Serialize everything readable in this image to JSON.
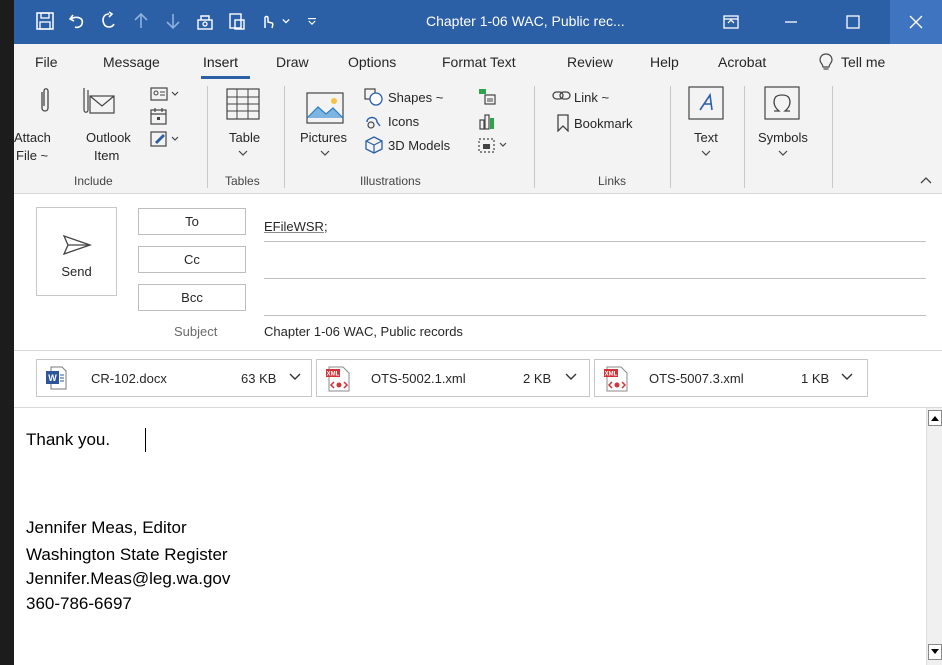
{
  "window": {
    "title": "Chapter 1-06 WAC, Public rec...",
    "accent": "#2b5fa6"
  },
  "quick_access": [
    "save-icon",
    "undo-icon",
    "redo-icon",
    "up-icon",
    "down-icon",
    "repeat-icon",
    "paste-icon",
    "touch-icon",
    "customize-icon"
  ],
  "tabs": [
    {
      "label": "File"
    },
    {
      "label": "Message"
    },
    {
      "label": "Insert"
    },
    {
      "label": "Draw"
    },
    {
      "label": "Options"
    },
    {
      "label": "Format Text"
    },
    {
      "label": "Review"
    },
    {
      "label": "Help"
    },
    {
      "label": "Acrobat"
    },
    {
      "label": "Tell me"
    }
  ],
  "active_tab": "Insert",
  "ribbon": {
    "include": {
      "label": "Include",
      "attach_file": [
        "Attach",
        "File ~"
      ],
      "outlook_item": [
        "Outlook",
        "Item"
      ]
    },
    "tables": {
      "label": "Tables",
      "table": "Table"
    },
    "illustrations": {
      "label": "Illustrations",
      "pictures": "Pictures",
      "shapes": "Shapes ~",
      "icons": "Icons",
      "models": "3D Models"
    },
    "links": {
      "label": "Links",
      "link": "Link ~",
      "bookmark": "Bookmark"
    },
    "text": {
      "label": "Text"
    },
    "symbols": {
      "label": "Symbols"
    }
  },
  "compose": {
    "send": "Send",
    "to_button": "To",
    "cc_button": "Cc",
    "bcc_button": "Bcc",
    "to_value": "EFileWSR;",
    "cc_value": "",
    "bcc_value": "",
    "subject_label": "Subject",
    "subject_value": "Chapter 1-06 WAC, Public records"
  },
  "attachments": [
    {
      "name": "CR-102.docx",
      "size": "63 KB",
      "type": "word"
    },
    {
      "name": "OTS-5002.1.xml",
      "size": "2 KB",
      "type": "xml"
    },
    {
      "name": "OTS-5007.3.xml",
      "size": "1 KB",
      "type": "xml"
    }
  ],
  "body": {
    "lines": [
      "Thank you.",
      "Jennifer Meas, Editor",
      "Washington State Register",
      "Jennifer.Meas@leg.wa.gov",
      "360-786-6697"
    ]
  }
}
